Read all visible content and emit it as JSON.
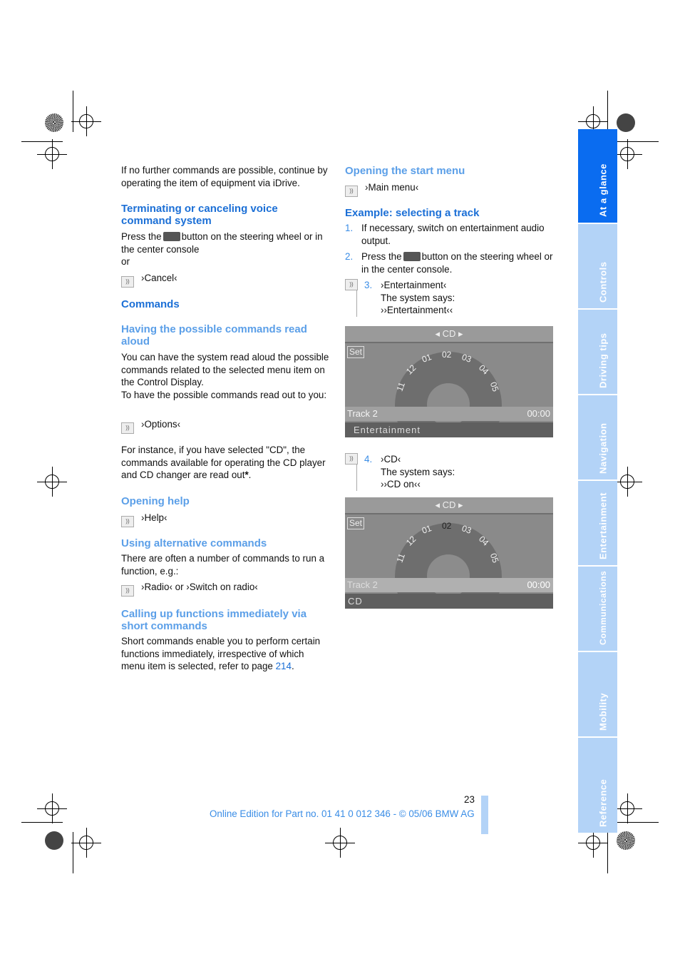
{
  "left": {
    "intro": "If no further commands are possible, continue by operating the item of equipment via iDrive.",
    "terminating": {
      "heading": "Terminating or canceling voice command system",
      "text_a": "Press the",
      "text_b": "button on the steering wheel or in the center console",
      "or": "or",
      "cmd": "›Cancel‹"
    },
    "commands_heading": "Commands",
    "read_aloud": {
      "heading": "Having the possible commands read aloud",
      "text1": "You can have the system read aloud the possible commands related to the selected menu item on the Control Display.",
      "text2": "To have the possible commands read out to you:",
      "cmd": "›Options‹",
      "text3": "For instance, if you have selected \"CD\", the commands available for operating the CD player and CD changer are read out",
      "star": "*",
      "period": "."
    },
    "help": {
      "heading": "Opening help",
      "cmd": "›Help‹"
    },
    "alt": {
      "heading": "Using alternative commands",
      "text": "There are often a number of commands to run a function, e.g.:",
      "cmd": "›Radio‹ or ›Switch on radio‹"
    },
    "short": {
      "heading": "Calling up functions immediately via short commands",
      "text": "Short commands enable you to perform certain functions immediately, irrespective of which menu item is selected, refer to page ",
      "page_link": "214",
      "end": "."
    }
  },
  "right": {
    "start": {
      "heading": "Opening the start menu",
      "cmd": "›Main menu‹"
    },
    "example": {
      "heading": "Example: selecting a track",
      "steps": [
        {
          "n": "1.",
          "text": "If necessary, switch on entertainment audio output."
        },
        {
          "n": "2.",
          "text_a": "Press the",
          "text_b": "button on the steering wheel or in the center console."
        },
        {
          "n": "3.",
          "cmd": "›Entertainment‹",
          "says": "The system says:",
          "reply": "››Entertainment‹‹"
        },
        {
          "n": "4.",
          "cmd": "›CD‹",
          "says": "The system says:",
          "reply": "››CD on‹‹"
        }
      ]
    }
  },
  "screens": [
    {
      "title": "CD",
      "set": "Set",
      "tracks": [
        "11",
        "12",
        "01",
        "02",
        "03",
        "04",
        "05"
      ],
      "track": "Track 2",
      "time": "00:00",
      "bottom": "Entertainment"
    },
    {
      "title": "CD",
      "set": "Set",
      "tracks": [
        "11",
        "12",
        "01",
        "02",
        "03",
        "04",
        "05"
      ],
      "track": "Track 2",
      "time": "00:00",
      "bottom": "CD"
    }
  ],
  "tabs": [
    {
      "label": "At a glance",
      "active": true
    },
    {
      "label": "Controls"
    },
    {
      "label": "Driving tips"
    },
    {
      "label": "Navigation"
    },
    {
      "label": "Entertainment"
    },
    {
      "label": "Communications"
    },
    {
      "label": "Mobility"
    },
    {
      "label": "Reference"
    }
  ],
  "footer": {
    "page_number": "23",
    "edition": "Online Edition for Part no. 01 41 0 012 346 - © 05/06 BMW AG"
  },
  "colors": {
    "heading": "#1b6fd6",
    "subheading": "#5b9fe8",
    "tab_active": "#0a6cf0",
    "tab_inactive": "#b3d3f7"
  }
}
